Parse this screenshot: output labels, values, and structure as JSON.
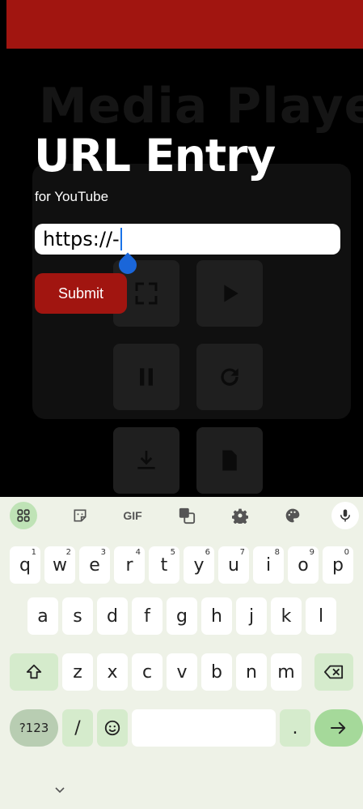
{
  "app": {
    "background_title": "Media Player",
    "overlay": {
      "title": "URL Entry",
      "subtitle": "for YouTube",
      "url_value": "https://-",
      "submit_label": "Submit"
    },
    "controls": [
      "fullscreen-icon",
      "play-icon",
      "pause-icon",
      "refresh-icon",
      "download-icon",
      "upload-file-icon"
    ]
  },
  "keyboard": {
    "toolbar": {
      "gif_label": "GIF"
    },
    "row1": [
      {
        "label": "q",
        "hint": "1"
      },
      {
        "label": "w",
        "hint": "2"
      },
      {
        "label": "e",
        "hint": "3"
      },
      {
        "label": "r",
        "hint": "4"
      },
      {
        "label": "t",
        "hint": "5"
      },
      {
        "label": "y",
        "hint": "6"
      },
      {
        "label": "u",
        "hint": "7"
      },
      {
        "label": "i",
        "hint": "8"
      },
      {
        "label": "o",
        "hint": "9"
      },
      {
        "label": "p",
        "hint": "0"
      }
    ],
    "row2": [
      "a",
      "s",
      "d",
      "f",
      "g",
      "h",
      "j",
      "k",
      "l"
    ],
    "row3": [
      "z",
      "x",
      "c",
      "v",
      "b",
      "n",
      "m"
    ],
    "row4": {
      "symbols_label": "?123",
      "slash_label": "/",
      "period_label": "."
    },
    "colors": {
      "accent": "#a11510",
      "key_special": "#d5ebcc",
      "enter": "#a5d99a"
    }
  }
}
